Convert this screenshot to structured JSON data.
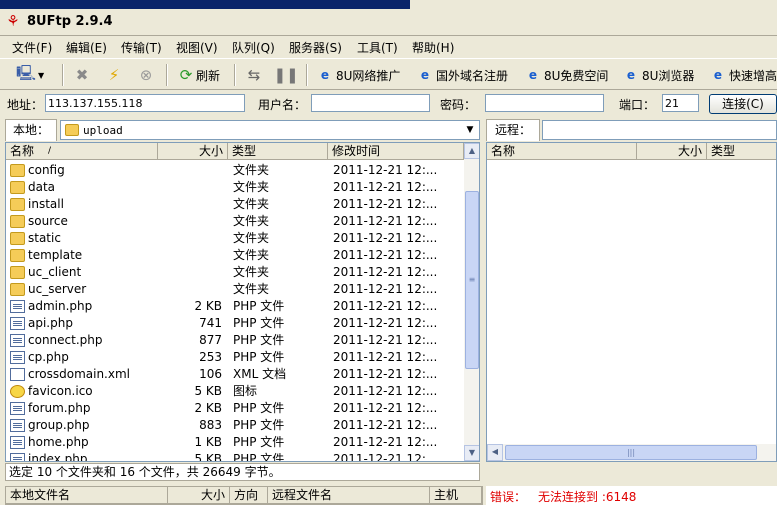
{
  "window": {
    "title": "8UFtp 2.9.4"
  },
  "menu": [
    "文件(F)",
    "编辑(E)",
    "传输(T)",
    "视图(V)",
    "队列(Q)",
    "服务器(S)",
    "工具(T)",
    "帮助(H)"
  ],
  "toolbar": {
    "refresh": "刷新",
    "links": [
      "8U网络推广",
      "国外域名注册",
      "8U免费空间",
      "8U浏览器",
      "快速增高"
    ]
  },
  "connect": {
    "address_label": "地址：",
    "address_value": "113.137.155.118",
    "user_label": "用户名：",
    "user_value": "",
    "password_label": "密码：",
    "password_value": "",
    "port_label": "端口：",
    "port_value": "21",
    "connect_button": "连接(C)"
  },
  "local": {
    "tag": "本地：",
    "path": "upload",
    "columns": {
      "name": "名称",
      "sort": "/",
      "size": "大小",
      "type": "类型",
      "modified": "修改时间"
    },
    "files": [
      {
        "name": "config",
        "size": "",
        "type": "文件夹",
        "modified": "2011-12-21 12:...",
        "icon": "folder"
      },
      {
        "name": "data",
        "size": "",
        "type": "文件夹",
        "modified": "2011-12-21 12:...",
        "icon": "folder"
      },
      {
        "name": "install",
        "size": "",
        "type": "文件夹",
        "modified": "2011-12-21 12:...",
        "icon": "folder"
      },
      {
        "name": "source",
        "size": "",
        "type": "文件夹",
        "modified": "2011-12-21 12:...",
        "icon": "folder"
      },
      {
        "name": "static",
        "size": "",
        "type": "文件夹",
        "modified": "2011-12-21 12:...",
        "icon": "folder"
      },
      {
        "name": "template",
        "size": "",
        "type": "文件夹",
        "modified": "2011-12-21 12:...",
        "icon": "folder"
      },
      {
        "name": "uc_client",
        "size": "",
        "type": "文件夹",
        "modified": "2011-12-21 12:...",
        "icon": "folder"
      },
      {
        "name": "uc_server",
        "size": "",
        "type": "文件夹",
        "modified": "2011-12-21 12:...",
        "icon": "folder"
      },
      {
        "name": "admin.php",
        "size": "2 KB",
        "type": "PHP 文件",
        "modified": "2011-12-21 12:...",
        "icon": "php"
      },
      {
        "name": "api.php",
        "size": "741",
        "type": "PHP 文件",
        "modified": "2011-12-21 12:...",
        "icon": "php"
      },
      {
        "name": "connect.php",
        "size": "877",
        "type": "PHP 文件",
        "modified": "2011-12-21 12:...",
        "icon": "php"
      },
      {
        "name": "cp.php",
        "size": "253",
        "type": "PHP 文件",
        "modified": "2011-12-21 12:...",
        "icon": "php"
      },
      {
        "name": "crossdomain.xml",
        "size": "106",
        "type": "XML 文档",
        "modified": "2011-12-21 12:...",
        "icon": "xml"
      },
      {
        "name": "favicon.ico",
        "size": "5 KB",
        "type": "图标",
        "modified": "2011-12-21 12:...",
        "icon": "ico"
      },
      {
        "name": "forum.php",
        "size": "2 KB",
        "type": "PHP 文件",
        "modified": "2011-12-21 12:...",
        "icon": "php"
      },
      {
        "name": "group.php",
        "size": "883",
        "type": "PHP 文件",
        "modified": "2011-12-21 12:...",
        "icon": "php"
      },
      {
        "name": "home.php",
        "size": "1 KB",
        "type": "PHP 文件",
        "modified": "2011-12-21 12:...",
        "icon": "php"
      },
      {
        "name": "index.php",
        "size": "5 KB",
        "type": "PHP 文件",
        "modified": "2011-12-21 12:...",
        "icon": "php"
      }
    ],
    "status": "选定 10 个文件夹和 16 个文件，共 26649 字节。"
  },
  "remote": {
    "tag": "远程：",
    "columns": {
      "name": "名称",
      "size": "大小",
      "type": "类型"
    }
  },
  "queue": {
    "columns": {
      "local": "本地文件名",
      "size": "大小",
      "direction": "方向",
      "remote": "远程文件名",
      "host": "主机"
    }
  },
  "error": {
    "label": "错误：",
    "message": "无法连接到 :6148"
  }
}
